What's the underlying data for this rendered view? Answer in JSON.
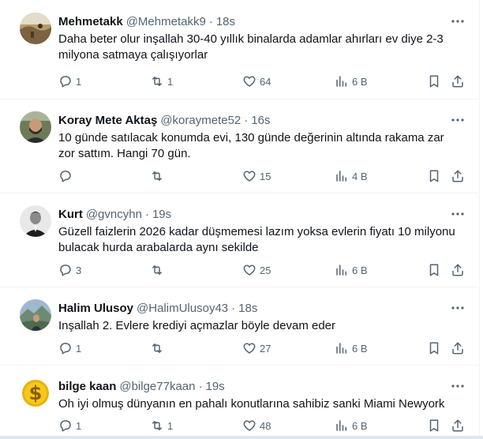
{
  "tweets": [
    {
      "name": "Mehmetakk",
      "handle": "@Mehmetakk9",
      "sep": "·",
      "time": "18s",
      "text": "Daha beter olur inşallah 30-40 yıllık binalarda adamlar ahırları ev diye 2-3 milyona satmaya çalışıyorlar",
      "replies": "1",
      "retweets": "1",
      "likes": "64",
      "views": "6 B",
      "avatar": "landscape-photo"
    },
    {
      "name": "Koray Mete Aktaş",
      "handle": "@koraymete52",
      "sep": "·",
      "time": "16s",
      "text": "10 günde satılacak konumda evi, 130 günde değerinin altında rakama zar zor sattım. Hangi 70 gün.",
      "replies": "",
      "retweets": "",
      "likes": "15",
      "views": "4 B",
      "avatar": "man-with-beard-photo"
    },
    {
      "name": "Kurt",
      "handle": "@gvncyhn",
      "sep": "·",
      "time": "19s",
      "text": "Güzell faizlerin 2026 kadar düşmemesi lazım yoksa evlerin fiyatı 10 milyonu bulacak hurda arabalarda aynı sekilde",
      "replies": "3",
      "retweets": "",
      "likes": "25",
      "views": "6 B",
      "avatar": "black-white-portrait"
    },
    {
      "name": "Halim Ulusoy",
      "handle": "@HalimUlusoy43",
      "sep": "·",
      "time": "18s",
      "text": "Inşallah 2. Evlere krediyi açmazlar böyle devam eder",
      "replies": "1",
      "retweets": "",
      "likes": "27",
      "views": "6 B",
      "avatar": "person-mountain-photo"
    },
    {
      "name": "bilge kaan",
      "handle": "@bilge77kaan",
      "sep": "·",
      "time": "19s",
      "text": "Oh iyi olmuş dünyanın en pahalı konutlarına sahibiz sanki Miami Newyork",
      "replies": "1",
      "retweets": "1",
      "likes": "48",
      "views": "6 B",
      "avatar": "gold-dollar-sign"
    }
  ],
  "icons": [
    "more-icon",
    "reply-icon",
    "retweet-icon",
    "like-icon",
    "views-icon",
    "bookmark-icon",
    "share-icon"
  ],
  "colors": {
    "text": "#0f1419",
    "muted": "#536471",
    "divider": "#eff3f4"
  }
}
